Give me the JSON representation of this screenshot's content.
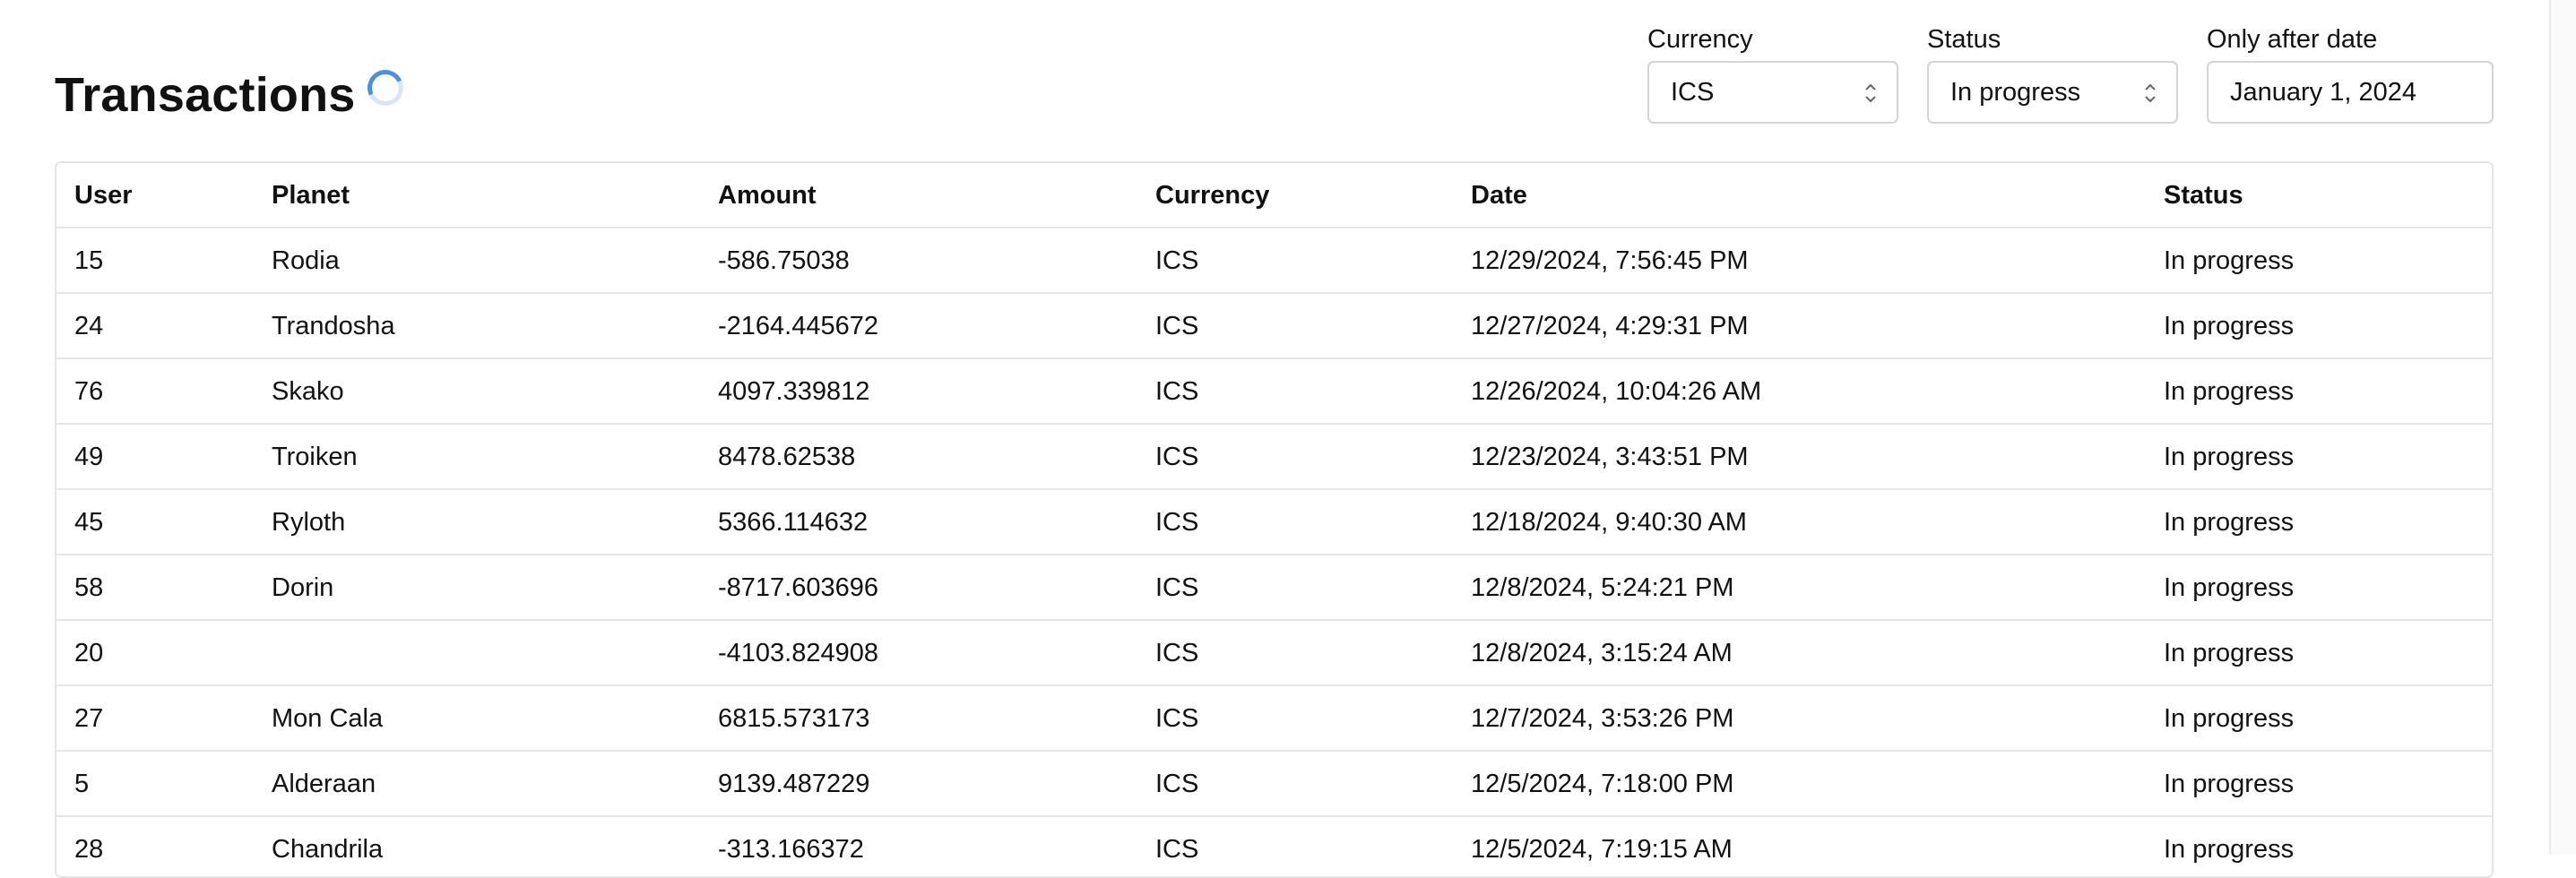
{
  "page": {
    "title": "Transactions"
  },
  "filters": {
    "currency": {
      "label": "Currency",
      "value": "ICS"
    },
    "status": {
      "label": "Status",
      "value": "In progress"
    },
    "date": {
      "label": "Only after date",
      "value": "January 1, 2024"
    }
  },
  "table": {
    "columns": [
      "User",
      "Planet",
      "Amount",
      "Currency",
      "Date",
      "Status"
    ],
    "rows": [
      [
        "15",
        "Rodia",
        "-586.75038",
        "ICS",
        "12/29/2024, 7:56:45 PM",
        "In progress"
      ],
      [
        "24",
        "Trandosha",
        "-2164.445672",
        "ICS",
        "12/27/2024, 4:29:31 PM",
        "In progress"
      ],
      [
        "76",
        "Skako",
        "4097.339812",
        "ICS",
        "12/26/2024, 10:04:26 AM",
        "In progress"
      ],
      [
        "49",
        "Troiken",
        "8478.62538",
        "ICS",
        "12/23/2024, 3:43:51 PM",
        "In progress"
      ],
      [
        "45",
        "Ryloth",
        "5366.114632",
        "ICS",
        "12/18/2024, 9:40:30 AM",
        "In progress"
      ],
      [
        "58",
        "Dorin",
        "-8717.603696",
        "ICS",
        "12/8/2024, 5:24:21 PM",
        "In progress"
      ],
      [
        "20",
        "",
        "-4103.824908",
        "ICS",
        "12/8/2024, 3:15:24 AM",
        "In progress"
      ],
      [
        "27",
        "Mon Cala",
        "6815.573173",
        "ICS",
        "12/7/2024, 3:53:26 PM",
        "In progress"
      ],
      [
        "5",
        "Alderaan",
        "9139.487229",
        "ICS",
        "12/5/2024, 7:18:00 PM",
        "In progress"
      ],
      [
        "28",
        "Chandrila",
        "-313.166372",
        "ICS",
        "12/5/2024, 7:19:15 AM",
        "In progress"
      ]
    ]
  }
}
